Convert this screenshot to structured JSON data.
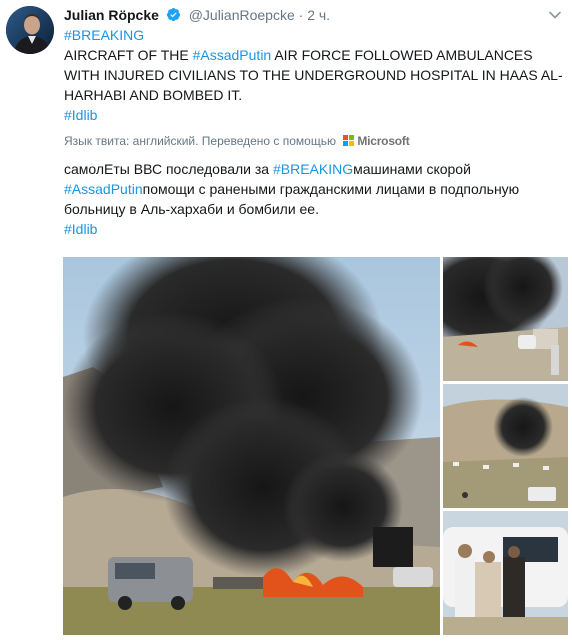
{
  "tweet": {
    "author_name": "Julian Röpcke",
    "handle": "@JulianRoepcke",
    "separator": "·",
    "time": "2 ч.",
    "verified": true,
    "original": {
      "line1_hashtag": "#BREAKING",
      "line2_prefix": "AIRCRAFT OF THE ",
      "line2_hashtag": "#AssadPutin",
      "line2_suffix": " AIR FORCE FOLLOWED AMBULANCES WITH INJURED CIVILIANS TO THE UNDERGROUND HOSPITAL IN HAAS AL-HARHABI AND BOMBED IT.",
      "line3_hashtag": "#Idlib"
    },
    "translation_note": "Язык твита: английский. Переведено с помощью",
    "translator_brand": "Microsoft",
    "translated": {
      "prefix": "самолЕты ВВС последовали за ",
      "hashtag1": "#BREAKING",
      "middle": "машинами скорой",
      "hashtag2": "#AssadPutin",
      "suffix": "помощи с ранеными гражданскими лицами в подпольную больницу в Аль-хархаби и бомбили ее.",
      "hashtag3": "#Idlib"
    }
  },
  "colors": {
    "link": "#1b95e0",
    "muted": "#657786",
    "text": "#14171a",
    "verified_badge": "#1da1f2"
  },
  "icons": {
    "verified": "verified-badge-icon",
    "caret": "chevron-down-icon",
    "translator": "microsoft-logo-icon"
  }
}
